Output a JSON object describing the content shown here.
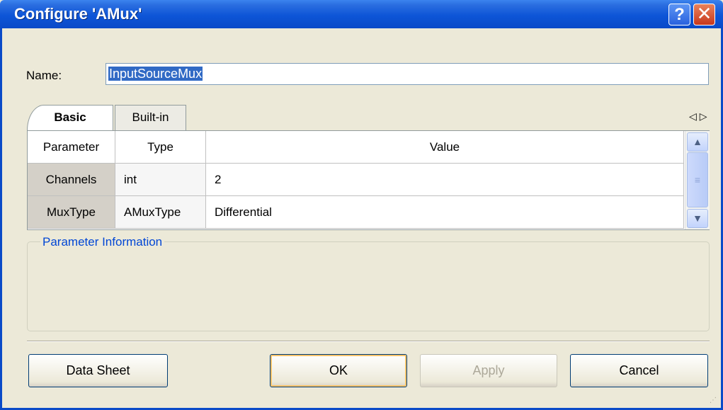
{
  "window": {
    "title": "Configure 'AMux'",
    "help_glyph": "?",
    "close_glyph": "✕"
  },
  "name_field": {
    "label": "Name:",
    "value": "InputSourceMux"
  },
  "tabs": [
    {
      "label": "Basic",
      "active": true
    },
    {
      "label": "Built-in",
      "active": false
    }
  ],
  "tab_nav": {
    "prev_glyph": "◁",
    "next_glyph": "▷"
  },
  "grid": {
    "headers": [
      "Parameter",
      "Type",
      "Value"
    ],
    "rows": [
      {
        "parameter": "Channels",
        "type": "int",
        "value": "2"
      },
      {
        "parameter": "MuxType",
        "type": "AMuxType",
        "value": "Differential"
      }
    ],
    "scroll_up_glyph": "▲",
    "scroll_down_glyph": "▼",
    "thumb_glyph": "≡"
  },
  "param_info": {
    "title": "Parameter Information"
  },
  "buttons": {
    "data_sheet": "Data Sheet",
    "ok": "OK",
    "apply": "Apply",
    "cancel": "Cancel"
  },
  "colors": {
    "titlebar": "#0a4ac8",
    "accent_text": "#0046d5",
    "face": "#ece9d8"
  }
}
